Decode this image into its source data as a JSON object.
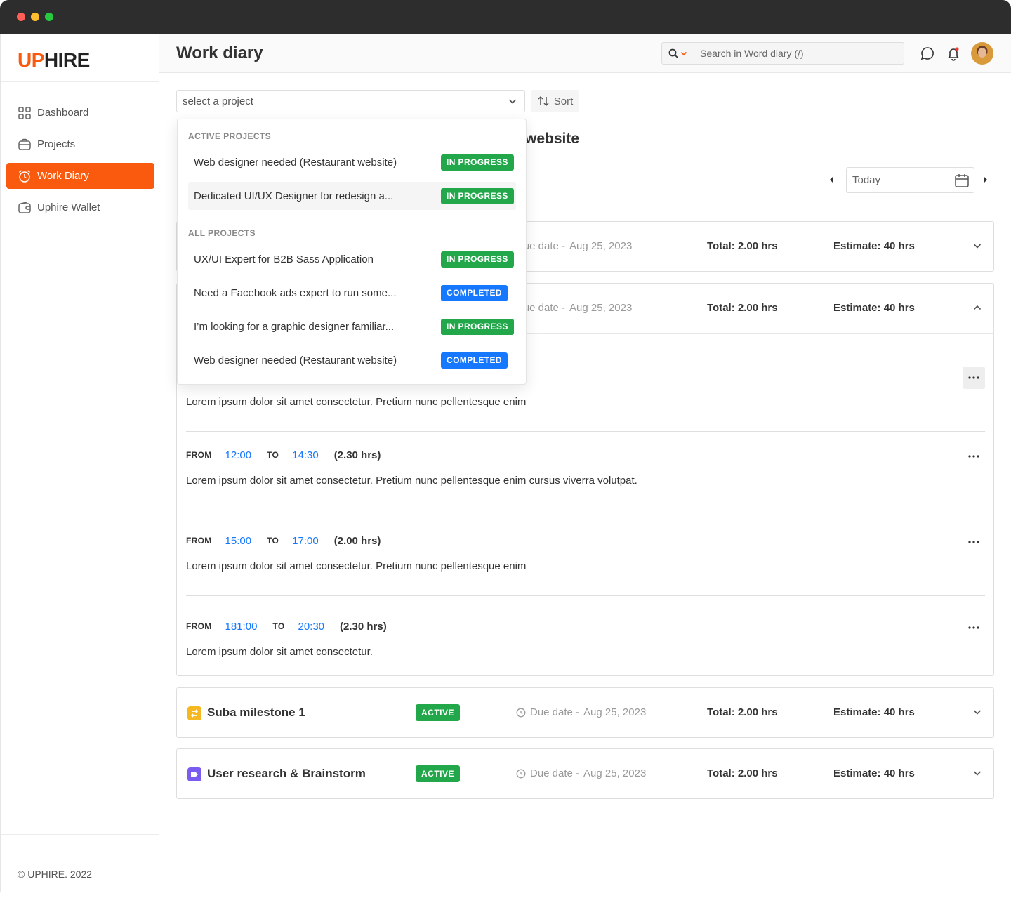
{
  "app": {
    "brand_up": "UP",
    "brand_hire": "HIRE",
    "page_title": "Work diary",
    "copyright": "© UPHIRE. 2022"
  },
  "colors": {
    "brand": "#f95a0e",
    "in_progress": "#22a84a",
    "completed": "#1677ff",
    "active": "#22a84a",
    "time_link": "#1677ff"
  },
  "sidebar": {
    "items": [
      {
        "label": "Dashboard",
        "icon": "grid-icon",
        "active": false
      },
      {
        "label": "Projects",
        "icon": "briefcase-icon",
        "active": false
      },
      {
        "label": "Work Diary",
        "icon": "alarm-clock-icon",
        "active": true
      },
      {
        "label": "Uphire Wallet",
        "icon": "wallet-icon",
        "active": false
      }
    ]
  },
  "header": {
    "search_placeholder": "Search in Word diary (/)",
    "icons": [
      "search-icon",
      "chat-icon",
      "bell-icon",
      "avatar"
    ]
  },
  "toolbar": {
    "project_placeholder": "select a project",
    "sort_label": "Sort",
    "date_value": "Today"
  },
  "project_heading_visible": "website",
  "dropdown": {
    "active_group_label": "ACTIVE PROJECTS",
    "all_group_label": "ALL PROJECTS",
    "active_projects": [
      {
        "name": "Web designer needed (Restaurant website)",
        "status": "IN PROGRESS"
      },
      {
        "name": "Dedicated UI/UX Designer for redesign a...",
        "status": "IN PROGRESS"
      }
    ],
    "all_projects": [
      {
        "name": "UX/UI Expert for B2B Sass Application",
        "status": "IN PROGRESS"
      },
      {
        "name": "Need a Facebook ads expert to run some...",
        "status": "COMPLETED"
      },
      {
        "name": "I’m looking for a graphic designer familiar...",
        "status": "IN PROGRESS"
      },
      {
        "name": "Web designer needed (Restaurant website)",
        "status": "COMPLETED"
      }
    ]
  },
  "milestones": [
    {
      "title": "",
      "due_label": "Due date -",
      "due_date": "Aug 25, 2023",
      "total": "Total: 2.00 hrs",
      "estimate": "Estimate: 40 hrs",
      "expanded": false
    },
    {
      "title": "",
      "due_label": "Due date -",
      "due_date": "Aug 25, 2023",
      "total": "Total: 2.00 hrs",
      "estimate": "Estimate: 40 hrs",
      "expanded": true
    },
    {
      "title": "Suba milestone 1",
      "status": "ACTIVE",
      "due_label": "Due date -",
      "due_date": "Aug 25, 2023",
      "total": "Total: 2.00 hrs",
      "estimate": "Estimate: 40 hrs",
      "expanded": false
    },
    {
      "title": "User research & Brainstorm",
      "status": "ACTIVE",
      "due_label": "Due date -",
      "due_date": "Aug 25, 2023",
      "total": "Total: 2.00 hrs",
      "estimate": "Estimate: 40 hrs",
      "expanded": false
    }
  ],
  "entries": [
    {
      "desc": "Lorem ipsum dolor sit amet consectetur. Pretium nunc pellentesque enim"
    },
    {
      "from_label": "FROM",
      "from": "12:00",
      "to_label": "TO",
      "to": "14:30",
      "duration": "(2.30 hrs)",
      "desc": "Lorem ipsum dolor sit amet consectetur. Pretium nunc pellentesque enim cursus viverra volutpat."
    },
    {
      "from_label": "FROM",
      "from": "15:00",
      "to_label": "TO",
      "to": "17:00",
      "duration": "(2.00 hrs)",
      "desc": "Lorem ipsum dolor sit amet consectetur. Pretium nunc pellentesque enim"
    },
    {
      "from_label": "FROM",
      "from": "181:00",
      "to_label": "TO",
      "to": "20:30",
      "duration": "(2.30 hrs)",
      "desc": "Lorem ipsum dolor sit amet consectetur."
    }
  ]
}
